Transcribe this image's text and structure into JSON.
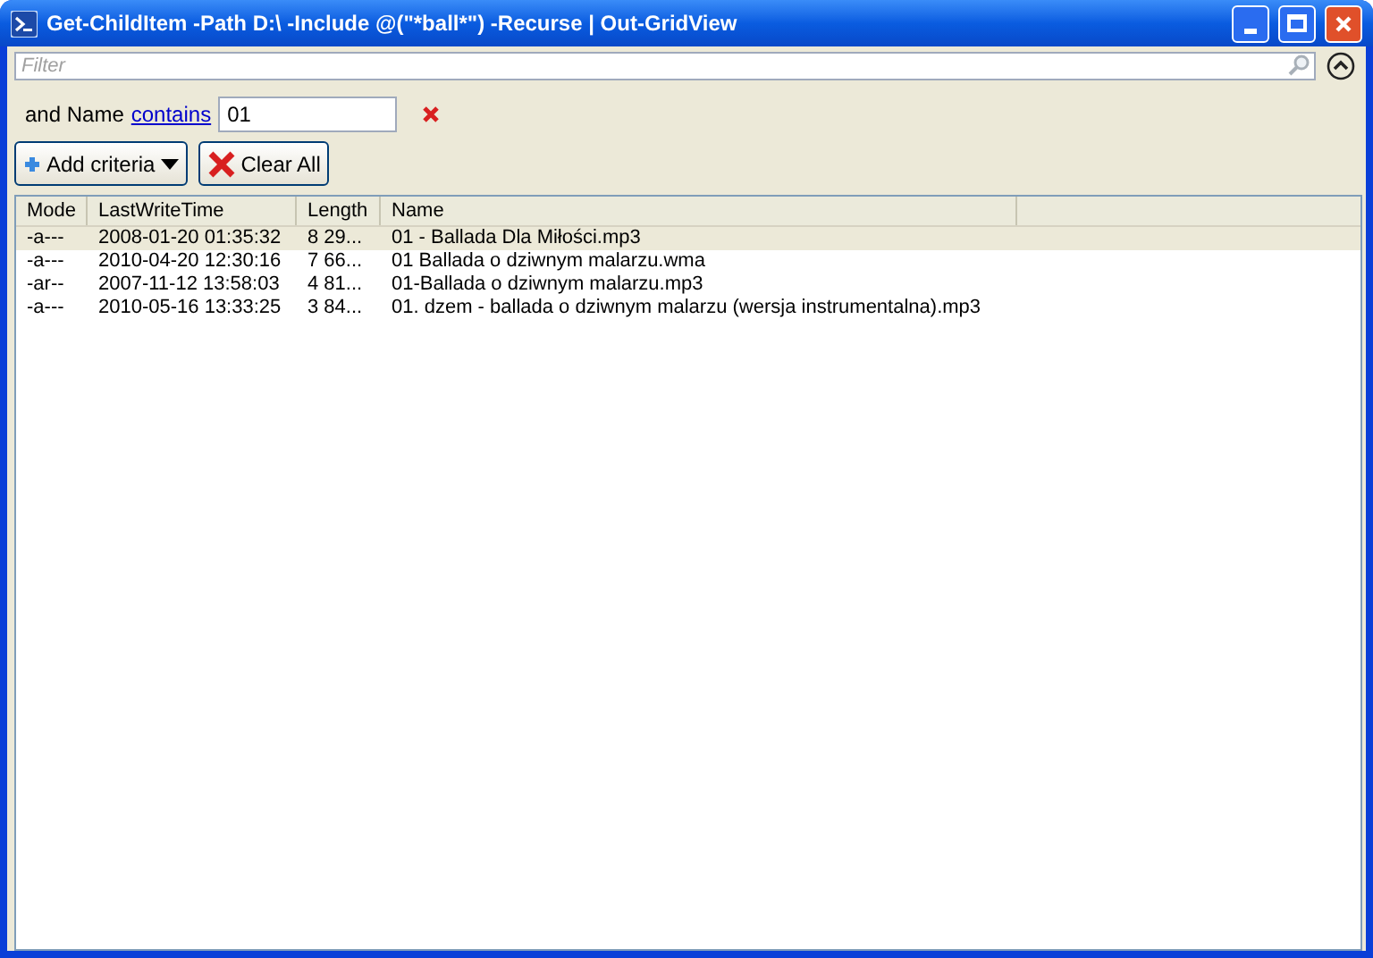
{
  "window": {
    "title": "Get-ChildItem -Path D:\\ -Include @(\"*ball*\") -Recurse | Out-GridView"
  },
  "filter": {
    "placeholder": "Filter"
  },
  "criteria": [
    {
      "prefix": "and Name",
      "operator": "contains",
      "value": "01"
    }
  ],
  "buttons": [
    {
      "label": "Add criteria",
      "kind": "add"
    },
    {
      "label": "Clear All",
      "kind": "clear"
    }
  ],
  "table": {
    "columns": [
      "Mode",
      "LastWriteTime",
      "Length",
      "Name"
    ],
    "rows": [
      {
        "cells": [
          "-a---",
          "2008-01-20 01:35:32",
          "8 29...",
          "01 - Ballada Dla Miłości.mp3"
        ],
        "selected": true
      },
      {
        "cells": [
          "-a---",
          "2010-04-20 12:30:16",
          "7 66...",
          "01 Ballada o dziwnym malarzu.wma"
        ],
        "selected": false
      },
      {
        "cells": [
          "-ar--",
          "2007-11-12 13:58:03",
          "4 81...",
          "01-Ballada o dziwnym malarzu.mp3"
        ],
        "selected": false
      },
      {
        "cells": [
          "-a---",
          "2010-05-16 13:33:25",
          "3 84...",
          "01. dzem - ballada o dziwnym malarzu (wersja instrumentalna).mp3"
        ],
        "selected": false
      }
    ]
  }
}
